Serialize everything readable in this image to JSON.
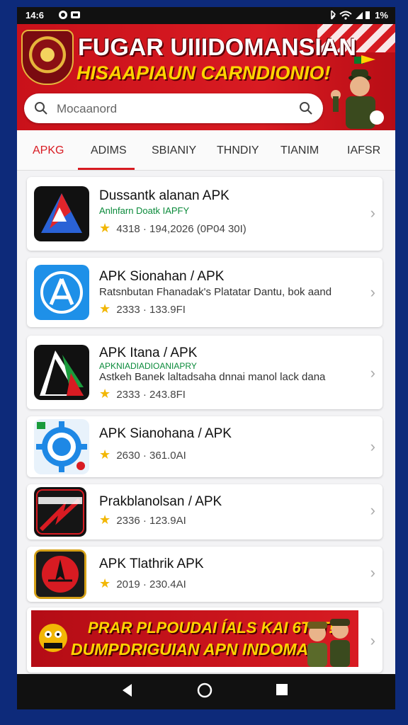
{
  "status": {
    "time": "14:6",
    "battery": "1%",
    "left_icons": [
      "notification-icon",
      "cast-icon"
    ],
    "right_icons": [
      "bluetooth-icon",
      "wifi-icon",
      "signal-icon"
    ]
  },
  "header": {
    "title_line1": "FUGAR UIIIDOMANSIAN",
    "title_line2": "HISAAPIAUN CARNDIONIO!",
    "search_placeholder": "Mocaanord"
  },
  "tabs": [
    "APKG",
    "ADIMS",
    "SBIANIY",
    "THNDIY",
    "TIANIM",
    "IAFSR"
  ],
  "active_tab": 0,
  "apps": [
    {
      "name": "Dussantk alanan APK",
      "sub": "Anlnfarn Doatk IAPFY",
      "desc": "",
      "rating": "4318",
      "info": "194,2026 (0P04 30I)",
      "icon": "android-red-blue"
    },
    {
      "name": "APK Sionahan / APK",
      "sub": "",
      "desc": "Ratsnbutan Fhanadak's Platatar Dantu, bok aand",
      "rating": "2333",
      "info": "133.9FI",
      "icon": "app-store-blue"
    },
    {
      "name": "APK Itana / APK",
      "sub": "APKNIADIADIOANIAPRY",
      "desc": "Astkeh Banek laltadsaha dnnai manol lack dana",
      "rating": "2333",
      "info": "243.8FI",
      "icon": "android-green"
    },
    {
      "name": "APK Sianohana / APK",
      "sub": "",
      "desc": "",
      "rating": "2630",
      "info": "361.0AI",
      "icon": "gear-blue"
    },
    {
      "name": "Prakblanolsan / APK",
      "sub": "",
      "desc": "",
      "rating": "2336",
      "info": "123.9AI",
      "icon": "red-black-badge"
    },
    {
      "name": "APK Tlathrik APK",
      "sub": "",
      "desc": "",
      "rating": "2019",
      "info": "230.4AI",
      "icon": "red-emblem"
    }
  ],
  "promo": {
    "line1": "PRAR PLPOUDAI ÍALS KAI 6TAT!",
    "line2": "DUMPDRIGUIAN APN INDOMA!"
  }
}
